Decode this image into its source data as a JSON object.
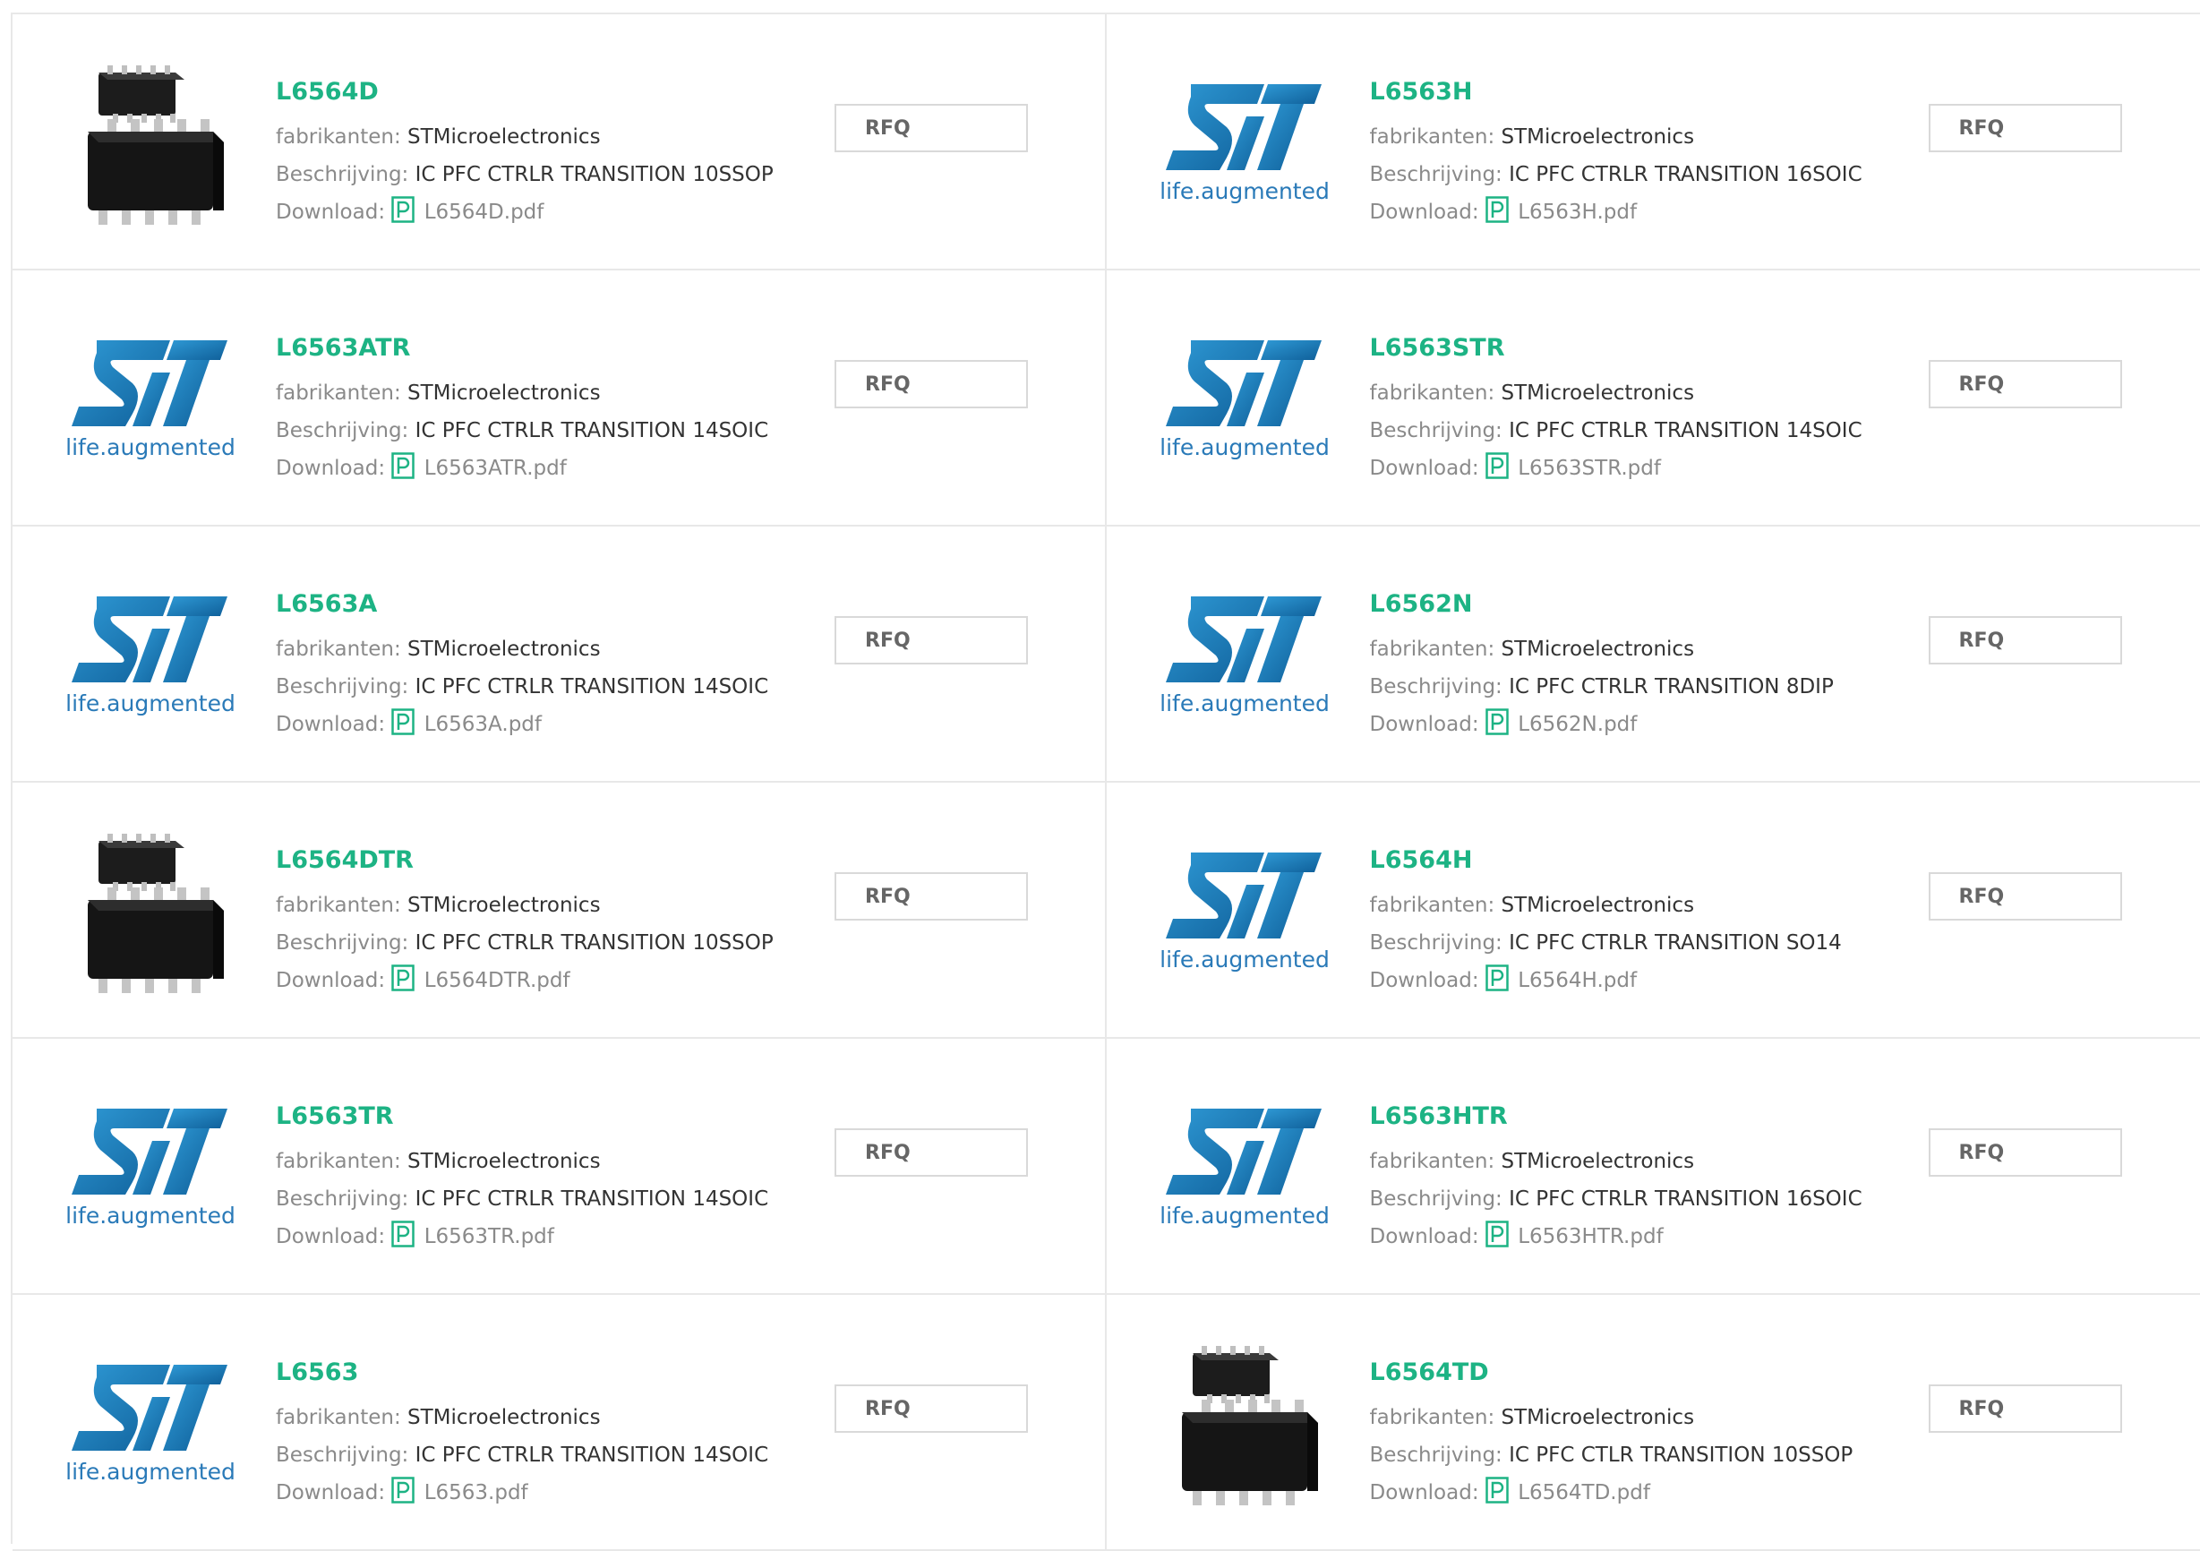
{
  "labels": {
    "manufacturer": "fabrikanten:",
    "description": "Beschrijving:",
    "download": "Download:",
    "rfq": "RFQ"
  },
  "brand_caption": "life.augmented",
  "colors": {
    "part_title": "#1db384",
    "pdf_icon": "#1db384",
    "st_logo_blue": "#1f86c2",
    "st_caption_blue": "#2a7ab8",
    "border": "#e8e8e8"
  },
  "products": [
    {
      "part": "L6564D",
      "manufacturer": "STMicroelectronics",
      "description": "IC PFC CTRLR TRANSITION 10SSOP",
      "file": "L6564D.pdf",
      "image": "chip-package"
    },
    {
      "part": "L6563H",
      "manufacturer": "STMicroelectronics",
      "description": "IC PFC CTRLR TRANSITION 16SOIC",
      "file": "L6563H.pdf",
      "image": "st-logo"
    },
    {
      "part": "L6563ATR",
      "manufacturer": "STMicroelectronics",
      "description": "IC PFC CTRLR TRANSITION 14SOIC",
      "file": "L6563ATR.pdf",
      "image": "st-logo"
    },
    {
      "part": "L6563STR",
      "manufacturer": "STMicroelectronics",
      "description": "IC PFC CTRLR TRANSITION 14SOIC",
      "file": "L6563STR.pdf",
      "image": "st-logo"
    },
    {
      "part": "L6563A",
      "manufacturer": "STMicroelectronics",
      "description": "IC PFC CTRLR TRANSITION 14SOIC",
      "file": "L6563A.pdf",
      "image": "st-logo"
    },
    {
      "part": "L6562N",
      "manufacturer": "STMicroelectronics",
      "description": "IC PFC CTRLR TRANSITION 8DIP",
      "file": "L6562N.pdf",
      "image": "st-logo"
    },
    {
      "part": "L6564DTR",
      "manufacturer": "STMicroelectronics",
      "description": "IC PFC CTRLR TRANSITION 10SSOP",
      "file": "L6564DTR.pdf",
      "image": "chip-package"
    },
    {
      "part": "L6564H",
      "manufacturer": "STMicroelectronics",
      "description": "IC PFC CTRLR TRANSITION SO14",
      "file": "L6564H.pdf",
      "image": "st-logo"
    },
    {
      "part": "L6563TR",
      "manufacturer": "STMicroelectronics",
      "description": "IC PFC CTRLR TRANSITION 14SOIC",
      "file": "L6563TR.pdf",
      "image": "st-logo"
    },
    {
      "part": "L6563HTR",
      "manufacturer": "STMicroelectronics",
      "description": "IC PFC CTRLR TRANSITION 16SOIC",
      "file": "L6563HTR.pdf",
      "image": "st-logo"
    },
    {
      "part": "L6563",
      "manufacturer": "STMicroelectronics",
      "description": "IC PFC CTRLR TRANSITION 14SOIC",
      "file": "L6563.pdf",
      "image": "st-logo"
    },
    {
      "part": "L6564TD",
      "manufacturer": "STMicroelectronics",
      "description": "IC PFC CTLR TRANSITION 10SSOP",
      "file": "L6564TD.pdf",
      "image": "chip-package"
    }
  ]
}
